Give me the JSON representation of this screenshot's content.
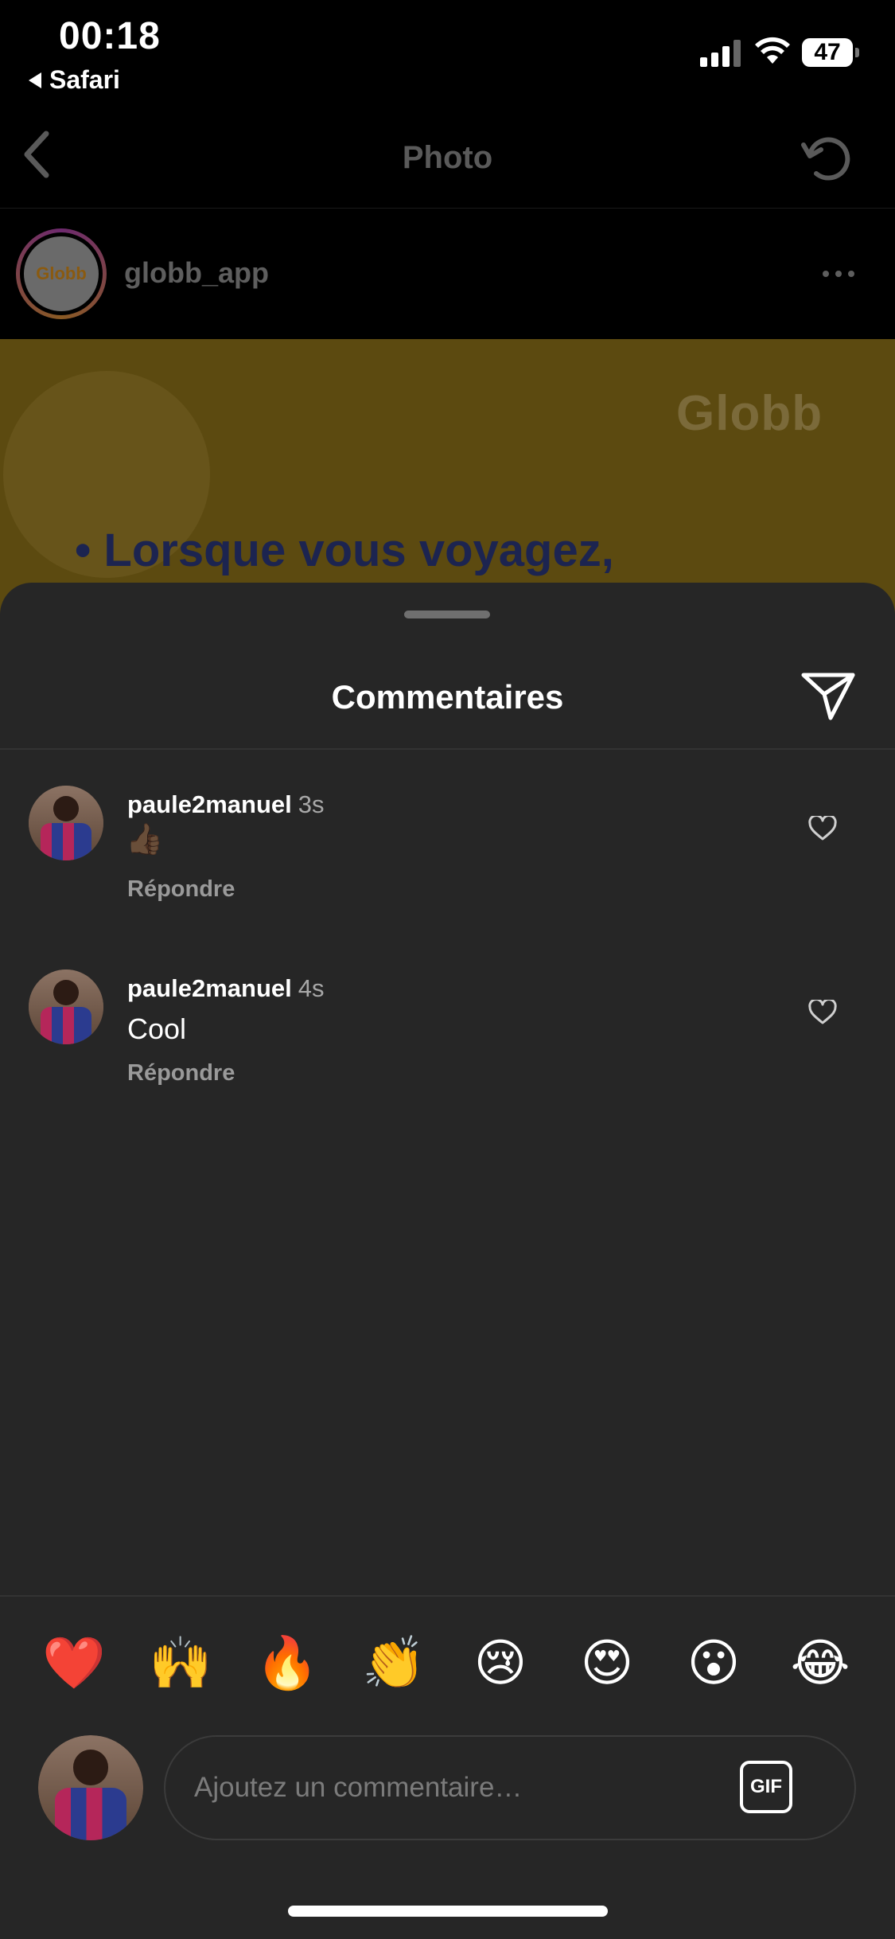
{
  "status_bar": {
    "time": "00:18",
    "back_app": "Safari",
    "battery": "47"
  },
  "nav": {
    "title": "Photo"
  },
  "post": {
    "account_name": "globb_app",
    "avatar_logo": "Globb",
    "image_logo": "Globb",
    "image_headline": "• Lorsque vous voyagez,"
  },
  "sheet": {
    "title": "Commentaires"
  },
  "comments": [
    {
      "user": "paule2manuel",
      "time_ago": "3s",
      "text": "👍🏾",
      "reply_label": "Répondre"
    },
    {
      "user": "paule2manuel",
      "time_ago": "4s",
      "text": "Cool",
      "reply_label": "Répondre"
    }
  ],
  "quick_reactions": [
    "❤️",
    "🙌",
    "🔥",
    "👏",
    "😢",
    "😍",
    "😮",
    "😂"
  ],
  "composer": {
    "placeholder": "Ajoutez un commentaire…",
    "gif_label": "GIF"
  },
  "colors": {
    "sheet_bg": "#262626",
    "page_bg": "#000000",
    "image_bg": "#5c4a10"
  }
}
